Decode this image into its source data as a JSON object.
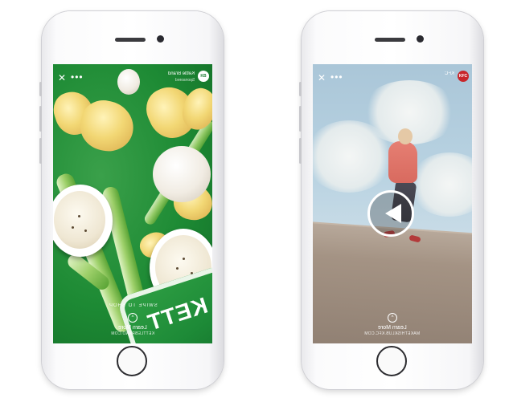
{
  "left_phone": {
    "brand_name": "Kettle Brand",
    "brand_sub": "Sponsored",
    "brand_logo": "KB",
    "close_icon": "✕",
    "more_icon": "•••",
    "swipe_text": "SWIPE TO SHOP",
    "cta_label": "Learn More",
    "cta_url": "KETTLEBRAND.COM",
    "bag_text": "KETT"
  },
  "right_phone": {
    "brand_name": "KFC",
    "brand_logo": "KFC",
    "close_icon": "✕",
    "more_icon": "•••",
    "cta_label": "Learn More",
    "cta_url": "MAKETHISKLUB.KFC.COM"
  },
  "icons": {
    "close": "close-icon",
    "more": "more-options-icon",
    "play": "play-icon",
    "chevron": "chevron-up-icon"
  },
  "colors": {
    "food_bg": "#1d8a34",
    "sky_bg": "#b9d3e2",
    "jacket": "#e67f73"
  }
}
